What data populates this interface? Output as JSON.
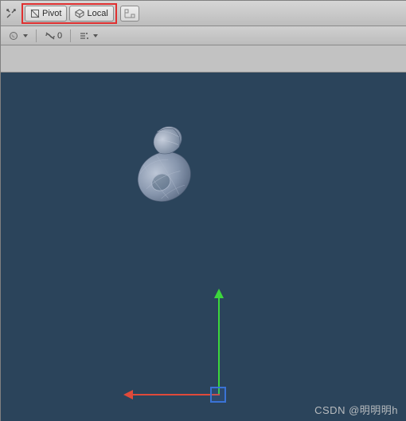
{
  "toolbar": {
    "pivot_label": "Pivot",
    "local_label": "Local"
  },
  "scene_toolbar": {
    "layers_count": "0"
  },
  "watermark": "CSDN @明明明h",
  "icons": {
    "tools": "tools-icon",
    "pivot": "pivot-icon",
    "local": "local-icon",
    "snap": "snap-icon",
    "shaded": "shaded-icon",
    "layers": "layers-icon",
    "fx": "fx-icon"
  }
}
